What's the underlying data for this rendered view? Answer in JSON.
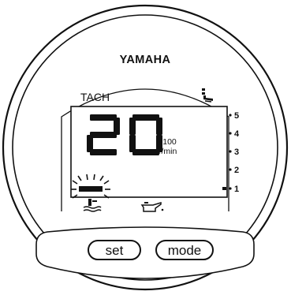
{
  "gauge": {
    "brand": "YAMAHA",
    "mode_label": "TACH",
    "reading": "20",
    "unit_line1": "x100",
    "unit_line2": "r/min",
    "scale": [
      "5",
      "4",
      "3",
      "2",
      "1"
    ],
    "trim_level": 1,
    "icons": {
      "trim": "engine-trim-icon",
      "water": "water-in-fuel-icon",
      "oil": "oil-pressure-icon"
    }
  },
  "buttons": {
    "set": "set",
    "mode": "mode"
  }
}
